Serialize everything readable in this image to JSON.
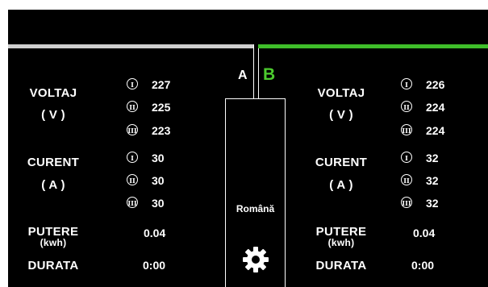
{
  "tabs": {
    "a_label": "A",
    "b_label": "B"
  },
  "language": "Română",
  "settings_icon": "gear-icon",
  "colors": {
    "bar_a": "#cfcfcf",
    "bar_b": "#3fbf2a",
    "tab_b": "#4ccb2e"
  },
  "phase_markers": [
    "I",
    "II",
    "III"
  ],
  "labels": {
    "voltage": "VOLTAJ",
    "voltage_unit": "( V )",
    "current": "CURENT",
    "current_unit": "( A )",
    "power": "PUTERE",
    "power_unit": "(kwh)",
    "duration": "DURATA"
  },
  "side_a": {
    "voltage": [
      "227",
      "225",
      "223"
    ],
    "current": [
      "30",
      "30",
      "30"
    ],
    "power": "0.04",
    "duration": "0:00"
  },
  "side_b": {
    "voltage": [
      "226",
      "224",
      "224"
    ],
    "current": [
      "32",
      "32",
      "32"
    ],
    "power": "0.04",
    "duration": "0:00"
  }
}
